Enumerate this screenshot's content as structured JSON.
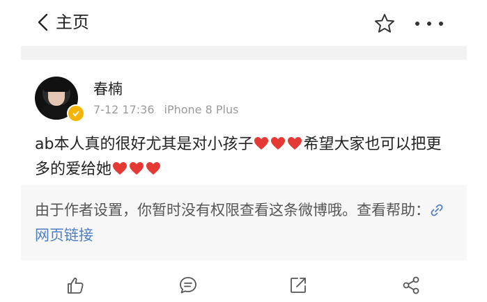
{
  "header": {
    "back_label": "主页",
    "back_icon": "chevron-left-icon",
    "favorite_icon": "star-icon",
    "more_icon": "more-icon"
  },
  "post": {
    "username": "春楠",
    "timestamp": "7-12 17:36",
    "source": "iPhone 8 Plus",
    "content_part1": "ab本人真的很好尤其是对小孩子",
    "content_part2": "希望大家也可以把更多的爱给她",
    "heart_color": "#e53935",
    "verified_badge_color": "#f4b400"
  },
  "notice": {
    "text": "由于作者设置，你暂时没有权限查看这条微博哦。查看帮助：",
    "link_label": "网页链接",
    "link_color": "#4d7ec4"
  },
  "actions": {
    "icons": [
      "like-icon",
      "comment-icon",
      "repost-icon",
      "share-icon"
    ]
  }
}
